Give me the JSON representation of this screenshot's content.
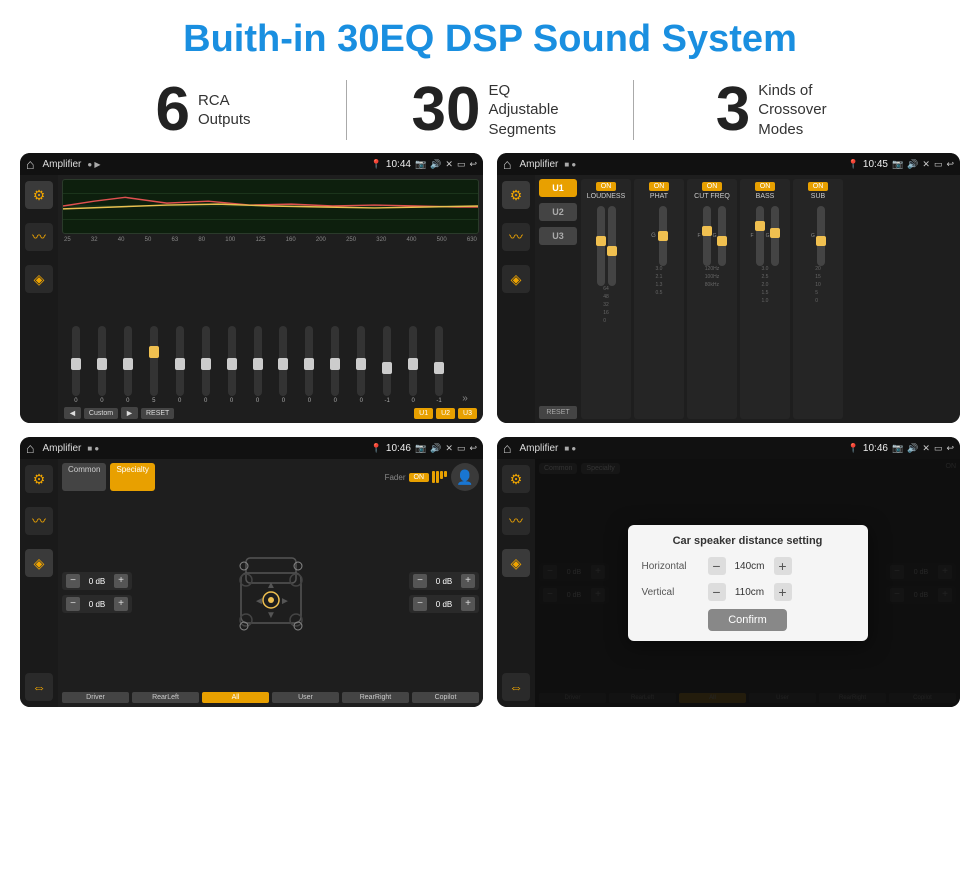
{
  "header": {
    "title": "Buith-in 30EQ DSP Sound System"
  },
  "stats": [
    {
      "number": "6",
      "label": "RCA\nOutputs"
    },
    {
      "number": "30",
      "label": "EQ Adjustable\nSegments"
    },
    {
      "number": "3",
      "label": "Kinds of\nCrossover Modes"
    }
  ],
  "screens": {
    "screen1": {
      "status": {
        "app": "Amplifier",
        "time": "10:44"
      },
      "eq_labels": [
        "25",
        "32",
        "40",
        "50",
        "63",
        "80",
        "100",
        "125",
        "160",
        "200",
        "250",
        "320",
        "400",
        "500",
        "630"
      ],
      "eq_values": [
        "0",
        "0",
        "0",
        "5",
        "0",
        "0",
        "0",
        "0",
        "0",
        "0",
        "0",
        "0",
        "-1",
        "0",
        "-1"
      ],
      "buttons": {
        "prev": "◄",
        "preset": "Custom",
        "next": "►",
        "reset": "RESET",
        "u1": "U1",
        "u2": "U2",
        "u3": "U3"
      }
    },
    "screen2": {
      "status": {
        "app": "Amplifier",
        "time": "10:45"
      },
      "units": [
        "U1",
        "U2",
        "U3"
      ],
      "panels": [
        {
          "label": "LOUDNESS",
          "on": true
        },
        {
          "label": "PHAT",
          "on": true
        },
        {
          "label": "CUT FREQ",
          "on": true
        },
        {
          "label": "BASS",
          "on": true
        },
        {
          "label": "SUB",
          "on": true
        }
      ],
      "reset": "RESET"
    },
    "screen3": {
      "status": {
        "app": "Amplifier",
        "time": "10:46"
      },
      "tabs": [
        "Common",
        "Specialty"
      ],
      "fader_label": "Fader",
      "fader_on": "ON",
      "zones": [
        {
          "label": "0 dB"
        },
        {
          "label": "0 dB"
        },
        {
          "label": "0 dB"
        },
        {
          "label": "0 dB"
        }
      ],
      "bottom_buttons": [
        "Driver",
        "RearLeft",
        "All",
        "User",
        "RearRight",
        "Copilot"
      ]
    },
    "screen4": {
      "status": {
        "app": "Amplifier",
        "time": "10:46"
      },
      "dialog": {
        "title": "Car speaker distance setting",
        "horizontal_label": "Horizontal",
        "horizontal_value": "140cm",
        "vertical_label": "Vertical",
        "vertical_value": "110cm",
        "confirm": "Confirm"
      },
      "bottom_buttons": [
        "Driver",
        "RearLeft",
        "All",
        "User",
        "RearRight",
        "Copilot"
      ]
    }
  }
}
